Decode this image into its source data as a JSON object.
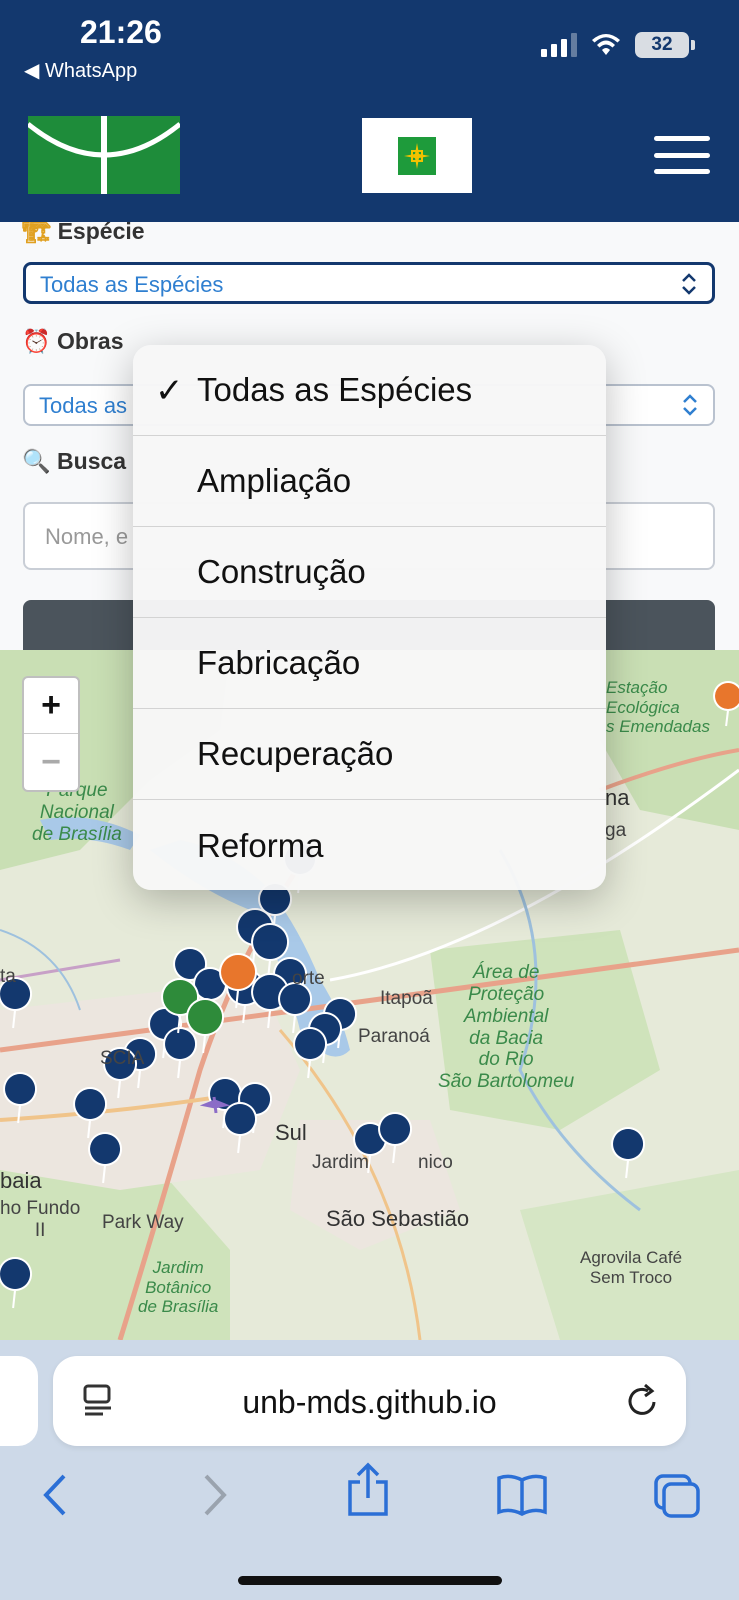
{
  "status_bar": {
    "time": "21:26",
    "back_app": "◀ WhatsApp",
    "battery": "32"
  },
  "form": {
    "especie_label": "Espécie",
    "especie_value": "Todas as Espécies",
    "obras_label": "Obras",
    "obras_value": "Todas as",
    "busca_label": "Busca",
    "busca_placeholder": "Nome, e",
    "icons": {
      "especie": "crane-icon",
      "obras": "alarm-clock-icon",
      "busca": "magnifier-icon"
    }
  },
  "dropdown": {
    "items": [
      {
        "label": "Todas as Espécies",
        "selected": true
      },
      {
        "label": "Ampliação",
        "selected": false
      },
      {
        "label": "Construção",
        "selected": false
      },
      {
        "label": "Fabricação",
        "selected": false
      },
      {
        "label": "Recuperação",
        "selected": false
      },
      {
        "label": "Reforma",
        "selected": false
      }
    ],
    "check": "✓"
  },
  "map": {
    "zoom_in": "+",
    "zoom_out": "−",
    "labels": {
      "parque": "Parque\nNacional\nde Brasília",
      "estacao": "Estação\nEcológica\ns Emendadas",
      "na": "na",
      "ga": "ga",
      "ta": "ta",
      "orte": "orte",
      "itapoa": "Itapoã",
      "paranoa": "Paranoá",
      "area": "Área de\nProteção\nAmbiental\nda Bacia\ndo Rio\nSão Bartolomeu",
      "scia": "SCIA",
      "sul": "Sul",
      "jardim": "Jardim",
      "nico": "nico",
      "baia": "baia",
      "fundo": "ho Fundo\nII",
      "parkway": "Park Way",
      "sao_sebastiao": "São Sebastião",
      "agrovila": "Agrovila Café\nSem Troco",
      "jardim_botanico": "Jardim\nBotânico\nde Brasília"
    },
    "colors": {
      "marker_blue": "#13386e",
      "marker_green": "#2e8b3a",
      "marker_orange": "#e8762c",
      "water": "#a9c9e8"
    }
  },
  "browser": {
    "url": "unb-mds.github.io"
  },
  "colors": {
    "header": "#13386e",
    "accent": "#2f7fd0",
    "browser_bar": "#cdd9e8"
  }
}
